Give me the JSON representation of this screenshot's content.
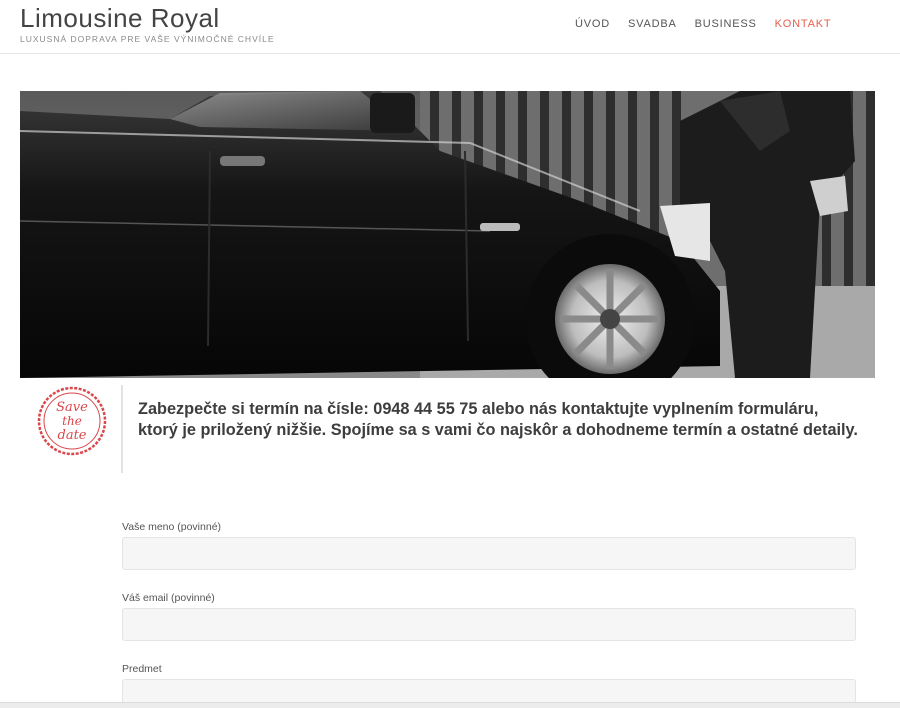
{
  "header": {
    "site_title": "Limousine Royal",
    "tagline": "LUXUSNÁ DOPRAVA PRE VAŠE VÝNIMOČNÉ CHVÍLE",
    "nav": [
      {
        "label": "ÚVOD",
        "active": false
      },
      {
        "label": "SVADBA",
        "active": false
      },
      {
        "label": "BUSINESS",
        "active": false
      },
      {
        "label": "KONTAKT",
        "active": true
      }
    ]
  },
  "hero": {
    "image": "black-sedan-chauffeur-photo"
  },
  "notice": {
    "stamp_text": [
      "Save",
      "the",
      "date"
    ],
    "stamp_color": "#d9474a",
    "text": "Zabezpečte si termín na čísle: 0948  44 55 75 alebo nás kontaktujte vyplnením formuláru, ktorý je priložený nižšie. Spojíme sa s vami čo najskôr a dohodneme termín a ostatné detaily."
  },
  "form": {
    "fields": [
      {
        "label": "Vaše meno (povinné)",
        "value": ""
      },
      {
        "label": "Váš email (povinné)",
        "value": ""
      },
      {
        "label": "Predmet",
        "value": ""
      }
    ]
  },
  "colors": {
    "accent": "#e4604d",
    "input_bg": "#f6f6f6"
  }
}
